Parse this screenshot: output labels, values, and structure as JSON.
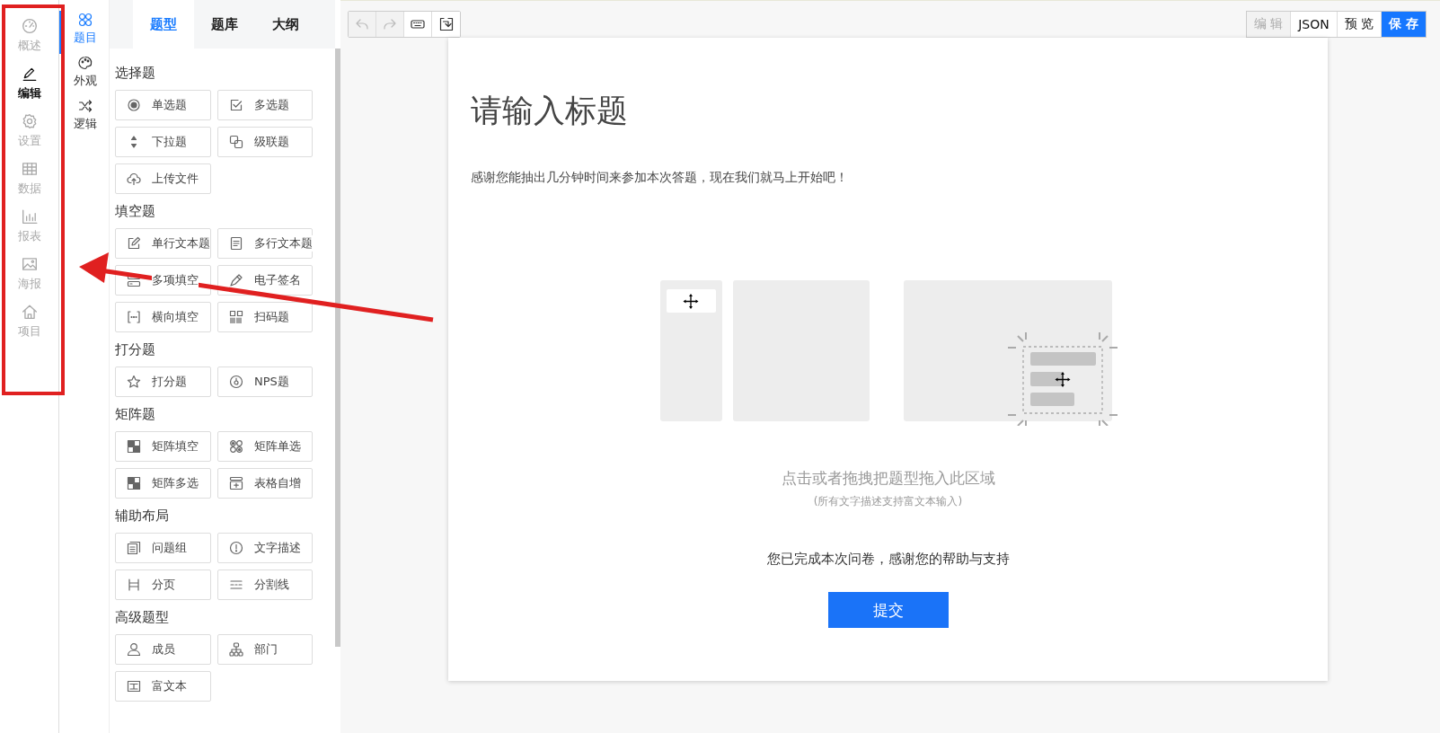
{
  "nav": {
    "items": [
      {
        "label": "概述",
        "selected": false
      },
      {
        "label": "编辑",
        "selected": true
      },
      {
        "label": "设置",
        "selected": false
      },
      {
        "label": "数据",
        "selected": false
      },
      {
        "label": "报表",
        "selected": false
      },
      {
        "label": "海报",
        "selected": false
      },
      {
        "label": "项目",
        "selected": false
      }
    ]
  },
  "subnav": {
    "items": [
      {
        "label": "题目",
        "selected": true
      },
      {
        "label": "外观",
        "selected": false
      },
      {
        "label": "逻辑",
        "selected": false
      }
    ]
  },
  "panel": {
    "tabs": [
      {
        "label": "题型",
        "selected": true
      },
      {
        "label": "题库",
        "selected": false
      },
      {
        "label": "大纲",
        "selected": false
      }
    ],
    "groups": [
      {
        "title": "选择题",
        "items": [
          "单选题",
          "多选题",
          "下拉题",
          "级联题",
          "上传文件"
        ]
      },
      {
        "title": "填空题",
        "items": [
          "单行文本题",
          "多行文本题",
          "多项填空",
          "电子签名",
          "横向填空",
          "扫码题"
        ]
      },
      {
        "title": "打分题",
        "items": [
          "打分题",
          "NPS题"
        ]
      },
      {
        "title": "矩阵题",
        "items": [
          "矩阵填空",
          "矩阵单选",
          "矩阵多选",
          "表格自增"
        ]
      },
      {
        "title": "辅助布局",
        "items": [
          "问题组",
          "文字描述",
          "分页",
          "分割线"
        ]
      },
      {
        "title": "高级题型",
        "items": [
          "成员",
          "部门",
          "富文本"
        ]
      }
    ]
  },
  "toolbar": {
    "tools": [
      {
        "disabled": true
      },
      {
        "disabled": true
      },
      {
        "disabled": false
      },
      {
        "disabled": false
      }
    ],
    "modes": [
      {
        "label": "编 辑",
        "kind": "disabled"
      },
      {
        "label": "JSON",
        "kind": "default"
      },
      {
        "label": "预 览",
        "kind": "default"
      },
      {
        "label": "保 存",
        "kind": "primary"
      }
    ]
  },
  "survey": {
    "title": "请输入标题",
    "description": "感谢您能抽出几分钟时间来参加本次答题，现在我们就马上开始吧！",
    "drop_hint": "点击或者拖拽把题型拖入此区域",
    "drop_subhint": "(所有文字描述支持富文本输入)",
    "completion": "您已完成本次问卷，感谢您的帮助与支持",
    "submit": "提交"
  }
}
